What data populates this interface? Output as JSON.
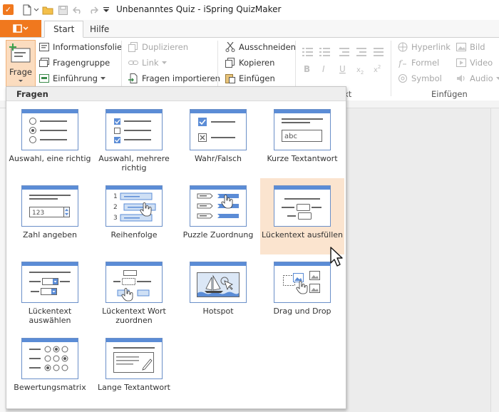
{
  "window": {
    "title": "Unbenanntes Quiz - iSpring QuizMaker"
  },
  "tabs": {
    "start": "Start",
    "hilfe": "Hilfe"
  },
  "ribbon": {
    "frage_label": "Frage",
    "informationsfolie": "Informationsfolie",
    "fragengruppe": "Fragengruppe",
    "einfuehrung": "Einführung",
    "duplizieren": "Duplizieren",
    "link": "Link",
    "fragen_importieren": "Fragen importieren",
    "ausschneiden": "Ausschneiden",
    "kopieren": "Kopieren",
    "einfuegen": "Einfügen",
    "hyperlink": "Hyperlink",
    "formel": "Formel",
    "symbol": "Symbol",
    "bild": "Bild",
    "video": "Video",
    "audio": "Audio",
    "group_text_tail": "xt",
    "group_einfuegen": "Einfügen"
  },
  "dropdown": {
    "header": "Fragen",
    "items": [
      {
        "label": "Auswahl, eine richtig"
      },
      {
        "label": "Auswahl, mehrere richtig"
      },
      {
        "label": "Wahr/Falsch"
      },
      {
        "label": "Kurze Textantwort"
      },
      {
        "label": "Zahl angeben"
      },
      {
        "label": "Reihenfolge"
      },
      {
        "label": "Puzzle Zuordnung"
      },
      {
        "label": "Lückentext ausfüllen"
      },
      {
        "label": "Lückentext auswählen"
      },
      {
        "label": "Lückentext Wort zuordnen"
      },
      {
        "label": "Hotspot"
      },
      {
        "label": "Drag und Drop"
      },
      {
        "label": "Bewertungsmatrix"
      },
      {
        "label": "Lange Textantwort"
      }
    ]
  },
  "thumb_text": {
    "abc": "abc",
    "num": "123",
    "n1": "1",
    "n2": "2",
    "n3": "3"
  },
  "colors": {
    "accent": "#f0781e",
    "thumb_blue": "#5b8cd6",
    "hover": "#fbe4cf"
  }
}
